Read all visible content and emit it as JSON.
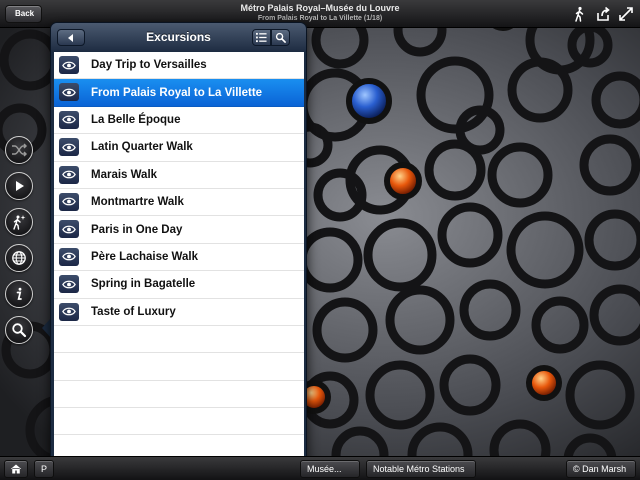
{
  "topbar": {
    "back_label": "Back",
    "title": "Métro Palais Royal–Musée du Louvre",
    "subtitle": "From Palais Royal to La Villette (1/18)",
    "icons": [
      "walker-icon",
      "share-icon",
      "fullscreen-icon"
    ]
  },
  "left_buttons": [
    "shuffle-icon",
    "play-icon",
    "walker-sparkle-icon",
    "globe-icon",
    "info-icon",
    "search-icon"
  ],
  "popover": {
    "title": "Excursions",
    "items": [
      {
        "label": "Day Trip to Versailles",
        "selected": false
      },
      {
        "label": "From Palais Royal to La Villette",
        "selected": true
      },
      {
        "label": "La Belle Époque",
        "selected": false
      },
      {
        "label": "Latin Quarter Walk",
        "selected": false
      },
      {
        "label": "Marais Walk",
        "selected": false
      },
      {
        "label": "Montmartre Walk",
        "selected": false
      },
      {
        "label": "Paris in One Day",
        "selected": false
      },
      {
        "label": "Père Lachaise Walk",
        "selected": false
      },
      {
        "label": "Spring in Bagatelle",
        "selected": false
      },
      {
        "label": "Taste of Luxury",
        "selected": false
      }
    ]
  },
  "bottombar": {
    "left_partial": "P",
    "musee_partial": "Musée...",
    "notable_label": "Notable Métro Stations",
    "credit": "© Dan Marsh"
  },
  "colors": {
    "selection_blue": "#0a63d6",
    "popover_navy": "#1c2c42",
    "bar_dark": "#141416"
  }
}
